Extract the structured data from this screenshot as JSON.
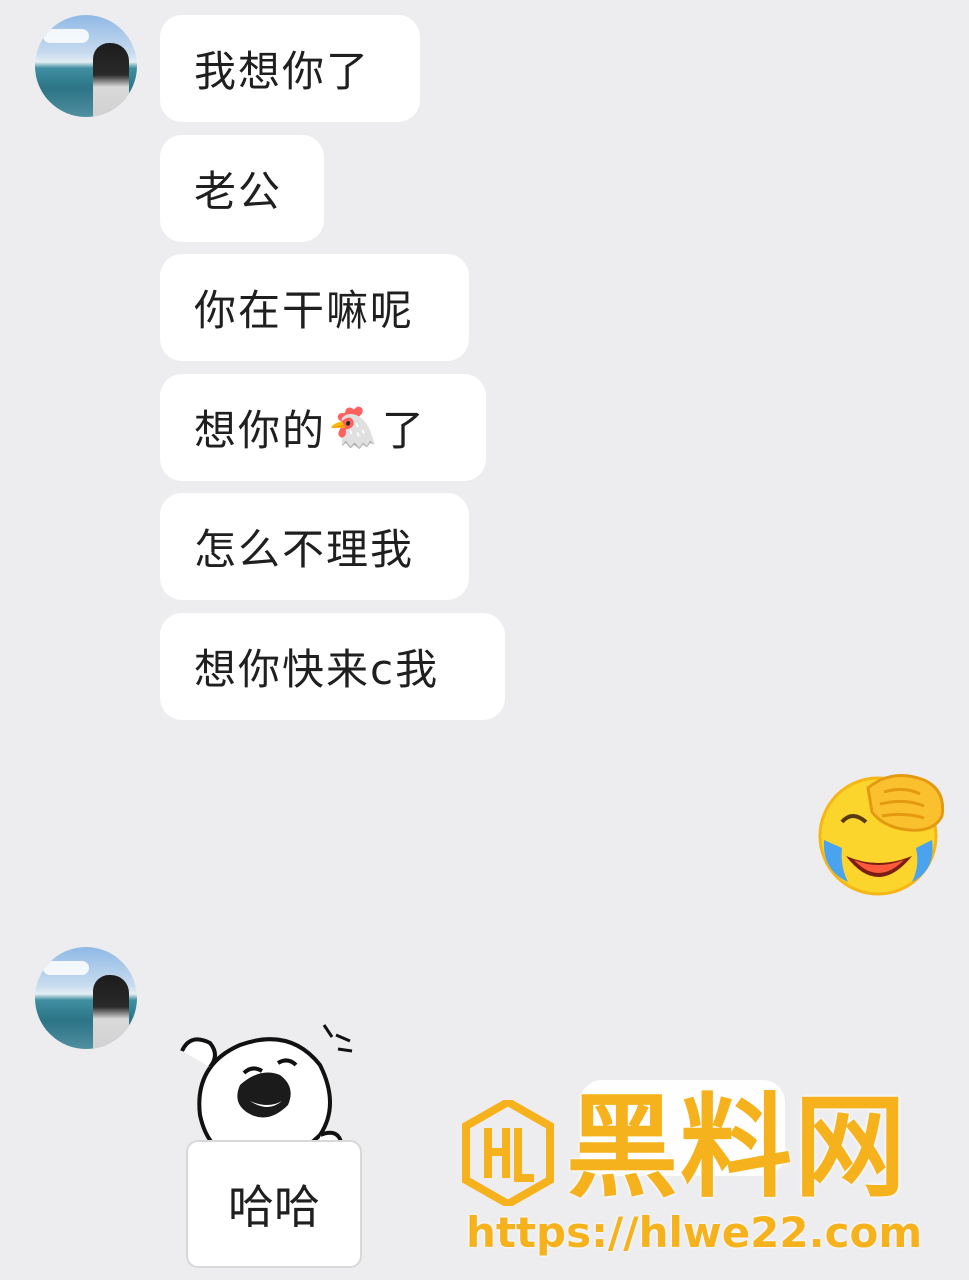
{
  "chat": {
    "messages": [
      {
        "text": "我想你了"
      },
      {
        "text": "老公"
      },
      {
        "text": "你在干嘛呢"
      },
      {
        "text_before": "想你的",
        "emoji": "🐔",
        "text_after": "了"
      },
      {
        "text": "怎么不理我"
      },
      {
        "text": "想你快来c我"
      }
    ],
    "reply_emoji": "laughing-crying-facepalm-icon",
    "sticker": {
      "text": "哈哈",
      "image": "laughing-cartoon-sticker-icon"
    }
  },
  "watermark": {
    "title": "黑料网",
    "url": "https://hlwe22.com",
    "color": "#f6b21d"
  },
  "colors": {
    "background": "#ededef",
    "bubble": "#ffffff",
    "text": "#1f1f1f"
  }
}
